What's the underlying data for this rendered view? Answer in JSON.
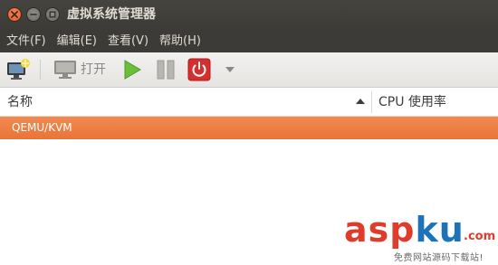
{
  "window": {
    "title": "虚拟系统管理器",
    "controls": [
      "close-icon",
      "minimize-icon",
      "maximize-icon"
    ]
  },
  "menubar": {
    "items": [
      {
        "label": "文件(F)"
      },
      {
        "label": "编辑(E)"
      },
      {
        "label": "查看(V)"
      },
      {
        "label": "帮助(H)"
      }
    ]
  },
  "toolbar": {
    "new_icon": "new-vm-icon",
    "open_icon": "monitor-icon",
    "open_label": "打开",
    "run_icon": "play-icon",
    "pause_icon": "pause-icon",
    "shutdown_icon": "power-icon",
    "more_icon": "dropdown-arrow-icon",
    "colors": {
      "play": "#6abf3a",
      "power": "#d62e2e"
    }
  },
  "table": {
    "columns": [
      {
        "label": "名称",
        "sort": "ascending"
      },
      {
        "label": "CPU 使用率"
      }
    ],
    "rows": [
      {
        "name": "QEMU/KVM",
        "selected": true
      }
    ],
    "selection_color": "#ed7d40"
  },
  "watermark": {
    "text_a": "asp",
    "text_b": "ku",
    "suffix": ".com",
    "subtitle": "免费网站源码下载站!"
  }
}
